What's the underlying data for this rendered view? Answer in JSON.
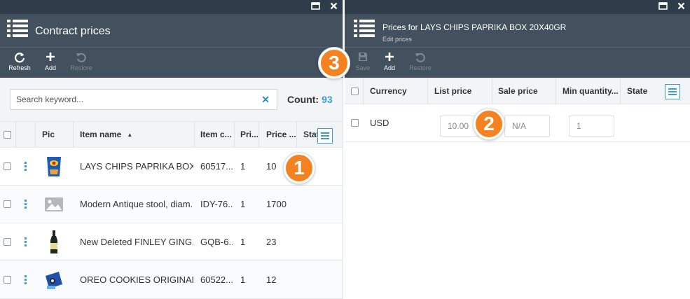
{
  "left": {
    "title": "Contract prices",
    "toolbar": {
      "refresh": "Refresh",
      "add": "Add",
      "restore": "Restore"
    },
    "search": {
      "placeholder": "Search keyword...",
      "value": ""
    },
    "count_label": "Count:",
    "count_value": "93",
    "columns": {
      "pic": "Pic",
      "item_name": "Item name",
      "item_code": "Item c...",
      "priority": "Pri...",
      "price": "Price ...",
      "state": "Stat"
    },
    "sort_indicator": "▲",
    "rows": [
      {
        "name": "LAYS CHIPS PAPRIKA BOX ...",
        "code": "60517...",
        "priority": "1",
        "price": "10",
        "thumb": "chips-bag-image"
      },
      {
        "name": "Modern Antique stool, diam...",
        "code": "IDY-76...",
        "priority": "1",
        "price": "1700",
        "thumb": "image-placeholder-icon"
      },
      {
        "name": "New Deleted FINLEY GING...",
        "code": "GQB-6...",
        "priority": "1",
        "price": "23",
        "thumb": "bottle-image"
      },
      {
        "name": "OREO COOKIES ORIGINAL ...",
        "code": "60522...",
        "priority": "1",
        "price": "12",
        "thumb": "cookie-box-image"
      }
    ]
  },
  "right": {
    "title": "Prices for LAYS CHIPS PAPRIKA BOX 20X40GR",
    "subtitle": "Edit prices",
    "toolbar": {
      "save": "Save",
      "add": "Add",
      "restore": "Restore"
    },
    "columns": {
      "currency": "Currency",
      "list_price": "List price",
      "sale_price": "Sale price",
      "min_quantity": "Min quantity...",
      "state": "State"
    },
    "rows": [
      {
        "currency": "USD",
        "list_price": "10.00",
        "sale_price": "N/A",
        "min_quantity": "1"
      }
    ]
  },
  "badges": {
    "b1": "1",
    "b2": "2",
    "b3": "3"
  },
  "colors": {
    "accent": "#3a9bd6",
    "header_bg": "#43505e",
    "topbar_bg": "#2f3d4b",
    "badge": "#f58220"
  }
}
